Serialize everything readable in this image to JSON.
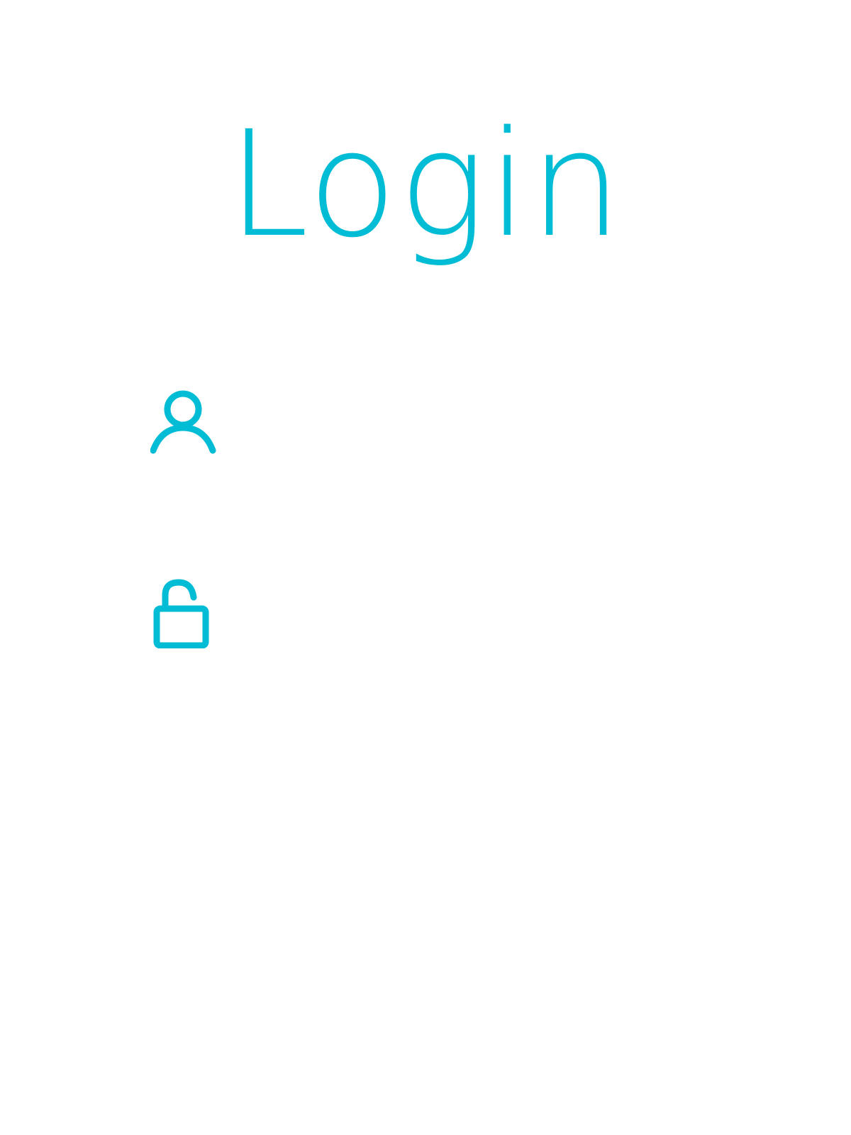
{
  "header": {
    "title": "Login"
  },
  "form": {
    "username": {
      "icon": "user-icon",
      "value": "",
      "placeholder": ""
    },
    "password": {
      "icon": "unlocked-padlock-icon",
      "value": "",
      "placeholder": ""
    }
  },
  "theme": {
    "accent": "#00BCD4",
    "background": "#FFFFFF"
  }
}
